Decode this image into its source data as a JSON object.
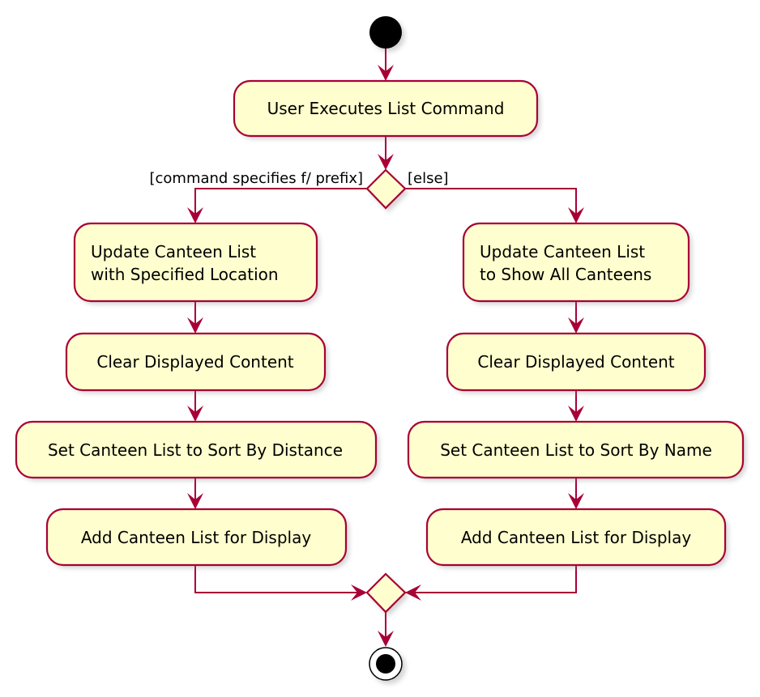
{
  "colors": {
    "node_fill": "#FEFECE",
    "node_border": "#A80036",
    "edge": "#A80036",
    "start": "#000000"
  },
  "start": {
    "icon": "start-node"
  },
  "end": {
    "icon": "end-node"
  },
  "initial_action": "User Executes List Command",
  "decision": {
    "guard_left": "[command specifies f/ prefix]",
    "guard_right": "[else]"
  },
  "left_branch": {
    "actions": [
      {
        "lines": [
          "Update Canteen List",
          "with Specified Location"
        ]
      },
      {
        "lines": [
          "Clear Displayed Content"
        ]
      },
      {
        "lines": [
          "Set Canteen List to Sort By Distance"
        ]
      },
      {
        "lines": [
          "Add Canteen List for Display"
        ]
      }
    ]
  },
  "right_branch": {
    "actions": [
      {
        "lines": [
          "Update Canteen List",
          "to Show All Canteens"
        ]
      },
      {
        "lines": [
          "Clear Displayed Content"
        ]
      },
      {
        "lines": [
          "Set Canteen List to Sort By Name"
        ]
      },
      {
        "lines": [
          "Add Canteen List for Display"
        ]
      }
    ]
  }
}
